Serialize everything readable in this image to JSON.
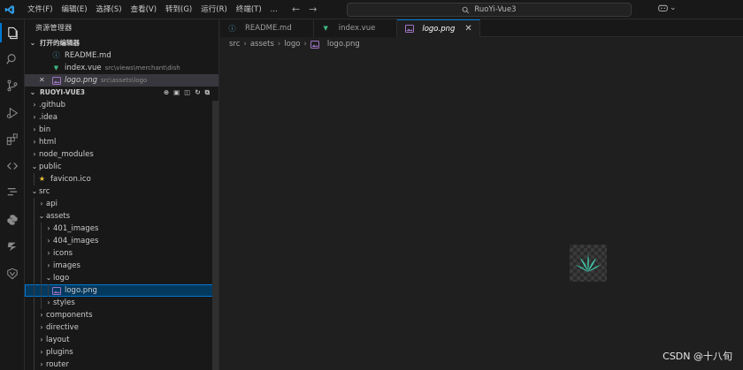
{
  "titlebar": {
    "menu": [
      "文件(F)",
      "编辑(E)",
      "选择(S)",
      "查看(V)",
      "转到(G)",
      "运行(R)",
      "终端(T)",
      "..."
    ],
    "search_text": "RuoYi-Vue3"
  },
  "colors": {
    "accent": "#0078d4",
    "vue_green": "#41b883",
    "info_blue": "#519aba",
    "image_purple": "#a074c4",
    "favicon_yellow": "#e8c33a",
    "logo_teal": "#3fd0b0"
  },
  "activity_icons": [
    "explorer-icon",
    "search-icon",
    "source-control-icon",
    "run-debug-icon",
    "extensions-icon",
    "remote-icon",
    "git-branch-icon",
    "python-icon",
    "vitest-icon",
    "gitlens-icon"
  ],
  "sidebar": {
    "title": "资源管理器",
    "open_editors": {
      "header": "打开的编辑器",
      "items": [
        {
          "name": "README.md",
          "path": "",
          "icon": "info"
        },
        {
          "name": "index.vue",
          "path": "src\\views\\merchant\\dish",
          "icon": "vue"
        },
        {
          "name": "logo.png",
          "path": "src\\assets\\logo",
          "icon": "image"
        }
      ]
    },
    "project": {
      "header": "RUOYI-VUE3",
      "tree": [
        {
          "name": ".github",
          "depth": 1,
          "type": "folder",
          "open": false
        },
        {
          "name": ".idea",
          "depth": 1,
          "type": "folder",
          "open": false
        },
        {
          "name": "bin",
          "depth": 1,
          "type": "folder",
          "open": false
        },
        {
          "name": "html",
          "depth": 1,
          "type": "folder",
          "open": false
        },
        {
          "name": "node_modules",
          "depth": 1,
          "type": "folder",
          "open": false
        },
        {
          "name": "public",
          "depth": 1,
          "type": "folder",
          "open": true
        },
        {
          "name": "favicon.ico",
          "depth": 2,
          "type": "favicon"
        },
        {
          "name": "src",
          "depth": 1,
          "type": "folder",
          "open": true
        },
        {
          "name": "api",
          "depth": 2,
          "type": "folder",
          "open": false
        },
        {
          "name": "assets",
          "depth": 2,
          "type": "folder",
          "open": true
        },
        {
          "name": "401_images",
          "depth": 3,
          "type": "folder",
          "open": false
        },
        {
          "name": "404_images",
          "depth": 3,
          "type": "folder",
          "open": false
        },
        {
          "name": "icons",
          "depth": 3,
          "type": "folder",
          "open": false
        },
        {
          "name": "images",
          "depth": 3,
          "type": "folder",
          "open": false
        },
        {
          "name": "logo",
          "depth": 3,
          "type": "folder",
          "open": true
        },
        {
          "name": "logo.png",
          "depth": 4,
          "type": "image",
          "active": true
        },
        {
          "name": "styles",
          "depth": 3,
          "type": "folder",
          "open": false
        },
        {
          "name": "components",
          "depth": 2,
          "type": "folder",
          "open": false
        },
        {
          "name": "directive",
          "depth": 2,
          "type": "folder",
          "open": false
        },
        {
          "name": "layout",
          "depth": 2,
          "type": "folder",
          "open": false
        },
        {
          "name": "plugins",
          "depth": 2,
          "type": "folder",
          "open": false
        },
        {
          "name": "router",
          "depth": 2,
          "type": "folder",
          "open": false
        }
      ]
    }
  },
  "tabs": [
    {
      "label": "README.md",
      "icon": "info",
      "active": false
    },
    {
      "label": "index.vue",
      "icon": "vue",
      "active": false
    },
    {
      "label": "logo.png",
      "icon": "image",
      "active": true
    }
  ],
  "breadcrumb": [
    "src",
    "assets",
    "logo",
    "logo.png"
  ],
  "watermark": "CSDN @十八旬"
}
